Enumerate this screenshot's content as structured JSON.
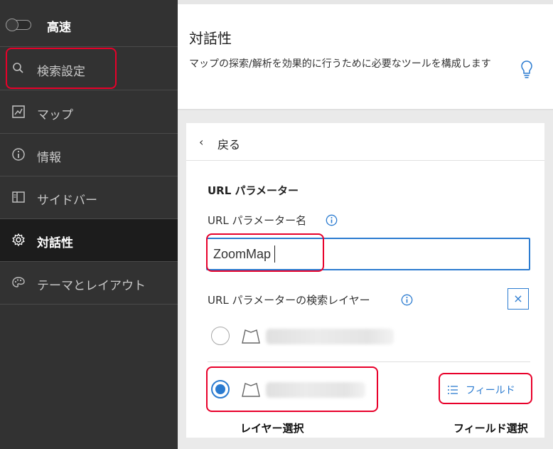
{
  "sidebar": {
    "toggle_label": "高速",
    "items": [
      {
        "label": "検索設定"
      },
      {
        "label": "マップ"
      },
      {
        "label": "情報"
      },
      {
        "label": "サイドバー"
      },
      {
        "label": "対話性"
      },
      {
        "label": "テーマとレイアウト"
      }
    ]
  },
  "main": {
    "title": "対話性",
    "description": "マップの探索/解析を効果的に行うために必要なツールを構成します",
    "back_label": "戻る",
    "section_title": "URL パラメーター",
    "param_name_label": "URL パラメーター名",
    "param_value": "ZoomMap",
    "layer_label": "URL パラメーターの検索レイヤー",
    "close_symbol": "×",
    "field_button_label": "フィールド"
  },
  "captions": {
    "layer_select": "レイヤー選択",
    "field_select": "フィールド選択"
  },
  "colors": {
    "sidebar_bg": "#323232",
    "accent": "#2b7bd0",
    "highlight": "#e8002a"
  }
}
